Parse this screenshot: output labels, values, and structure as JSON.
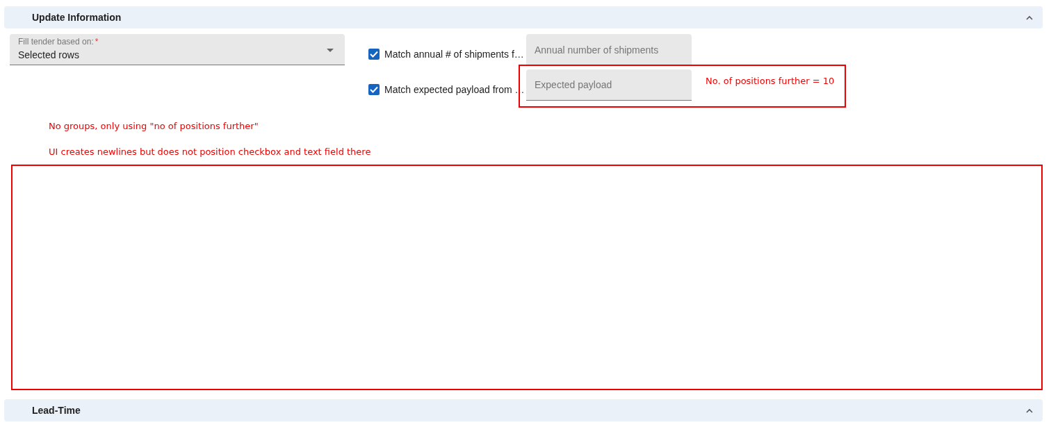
{
  "sections": [
    {
      "title": "Update Information",
      "expanded": true
    },
    {
      "title": "Lead-Time",
      "expanded": true
    }
  ],
  "fill_select": {
    "label": "Fill tender based on:",
    "required_mark": "*",
    "value": "Selected rows"
  },
  "match_rows": [
    {
      "label": "Match annual # of shipments f…",
      "checked": true,
      "placeholder": "Annual number of shipments"
    },
    {
      "label": "Match expected payload from …",
      "checked": true,
      "placeholder": "Expected payload"
    }
  ],
  "annotations": {
    "field_note": "No. of positions further = 10",
    "notes": [
      "No groups, only using \"no of positions further\"",
      "UI creates newlines but does not position checkbox and text field there"
    ]
  }
}
